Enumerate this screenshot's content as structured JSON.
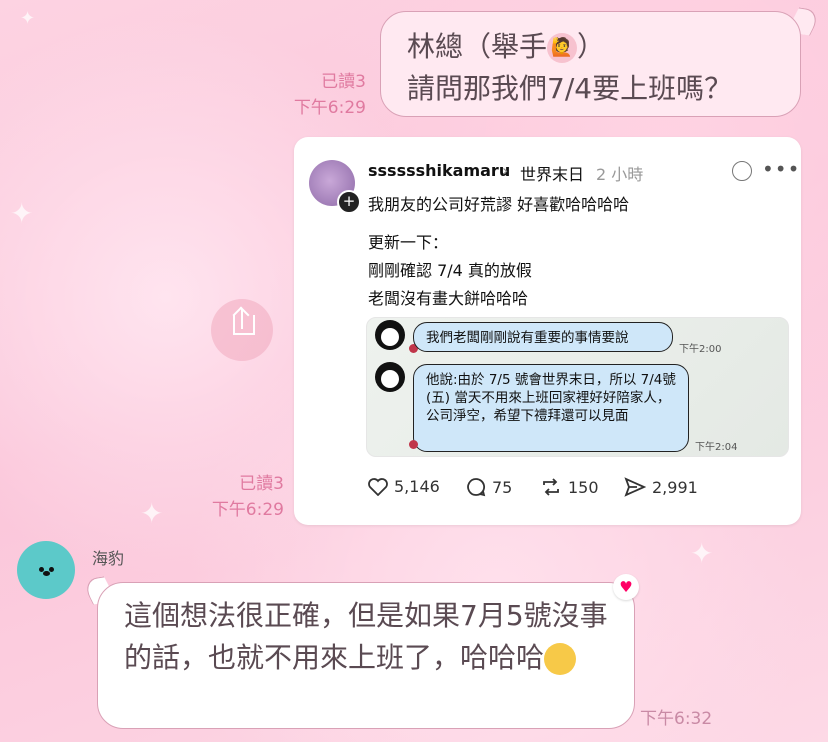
{
  "msg_out_1": {
    "line1_prefix": "林總（舉手",
    "line1_suffix": "）",
    "line2": "請問那我們7/4要上班嗎？",
    "read": "已讀3",
    "time": "下午6:29"
  },
  "shared_post": {
    "username": "sssssshikamaru",
    "topic": "世界末日",
    "ago": "2 小時",
    "lines": [
      "我朋友的公司好荒謬 好喜歡哈哈哈哈",
      "更新一下：",
      "剛剛確認 7/4 真的放假",
      "老闆沒有畫大餅哈哈哈"
    ],
    "chat": {
      "bubble1": "我們老闆剛剛說有重要的事情要說",
      "time1": "下午2:00",
      "bubble2": "他說:由於 7/5 號會世界末日，所以 7/4號 (五) 當天不用來上班回家裡好好陪家人，公司淨空，希望下禮拜還可以見面",
      "time2": "下午2:04"
    },
    "stats": {
      "likes": "5,146",
      "comments": "75",
      "reposts": "150",
      "shares": "2,991"
    }
  },
  "msg_out_2": {
    "read": "已讀3",
    "time": "下午6:29"
  },
  "msg_in": {
    "sender": "海豹",
    "text": "這個想法很正確，但是如果7月5號沒事的話，也就不用來上班了，哈哈哈",
    "time": "下午6:32"
  },
  "icons": [
    "raising-hand-emoji",
    "chevron-right-icon",
    "edit-icon",
    "more-icon",
    "heart-icon",
    "comment-icon",
    "repost-icon",
    "send-icon",
    "share-icon",
    "laughing-emoji",
    "heart-reaction-icon"
  ]
}
